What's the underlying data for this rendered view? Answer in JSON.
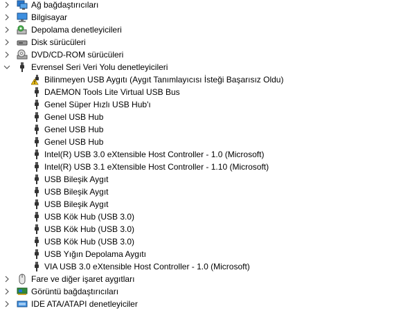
{
  "categories_before": [
    {
      "label": "Ağ bağdaştırıcıları",
      "icon": "network-adapter-icon"
    },
    {
      "label": "Bilgisayar",
      "icon": "computer-icon"
    },
    {
      "label": "Depolama denetleyicileri",
      "icon": "storage-controller-icon"
    },
    {
      "label": "Disk sürücüleri",
      "icon": "disk-drive-icon"
    },
    {
      "label": "DVD/CD-ROM sürücüleri",
      "icon": "dvd-drive-icon"
    }
  ],
  "usb_category": {
    "label": "Evrensel Seri Veri Yolu denetleyicileri",
    "icon": "usb-controller-icon",
    "expanded": true,
    "children": [
      {
        "label": "Bilinmeyen USB Aygıtı (Aygıt Tanımlayıcısı İsteği Başarısız Oldu)",
        "icon": "usb-warning-icon"
      },
      {
        "label": "DAEMON Tools Lite Virtual USB Bus",
        "icon": "usb-plug-icon"
      },
      {
        "label": "Genel Süper Hızlı USB Hub'ı",
        "icon": "usb-plug-icon"
      },
      {
        "label": "Genel USB Hub",
        "icon": "usb-plug-icon"
      },
      {
        "label": "Genel USB Hub",
        "icon": "usb-plug-icon"
      },
      {
        "label": "Genel USB Hub",
        "icon": "usb-plug-icon"
      },
      {
        "label": "Intel(R) USB 3.0 eXtensible Host Controller - 1.0 (Microsoft)",
        "icon": "usb-plug-icon"
      },
      {
        "label": "Intel(R) USB 3.1 eXtensible Host Controller - 1.10 (Microsoft)",
        "icon": "usb-plug-icon"
      },
      {
        "label": "USB Bileşik Aygıt",
        "icon": "usb-plug-icon"
      },
      {
        "label": "USB Bileşik Aygıt",
        "icon": "usb-plug-icon"
      },
      {
        "label": "USB Bileşik Aygıt",
        "icon": "usb-plug-icon"
      },
      {
        "label": "USB Kök Hub (USB 3.0)",
        "icon": "usb-plug-icon"
      },
      {
        "label": "USB Kök Hub (USB 3.0)",
        "icon": "usb-plug-icon"
      },
      {
        "label": "USB Kök Hub (USB 3.0)",
        "icon": "usb-plug-icon"
      },
      {
        "label": "USB Yığın Depolama Aygıtı",
        "icon": "usb-plug-icon"
      },
      {
        "label": "VIA USB 3.0 eXtensible Host Controller - 1.0 (Microsoft)",
        "icon": "usb-plug-icon"
      }
    ]
  },
  "categories_after": [
    {
      "label": "Fare ve diğer işaret aygıtları",
      "icon": "mouse-icon"
    },
    {
      "label": "Görüntü bağdaştırıcıları",
      "icon": "display-adapter-icon"
    },
    {
      "label": "IDE ATA/ATAPI denetleyiciler",
      "icon": "ide-controller-icon"
    }
  ],
  "colors": {
    "text": "#000000",
    "chevron": "#555555",
    "icon_gray": "#4a4a4a",
    "icon_blue": "#1e73d8",
    "warning": "#f5c518"
  }
}
